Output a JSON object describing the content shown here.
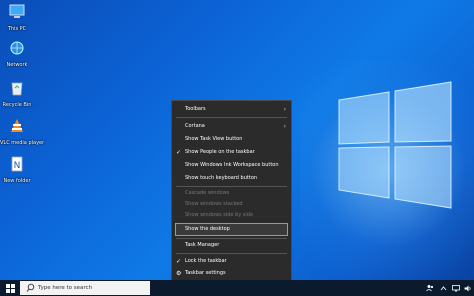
{
  "desktop_icons": [
    {
      "label": "This PC",
      "icon": "this-pc-icon"
    },
    {
      "label": "Network",
      "icon": "network-icon"
    },
    {
      "label": "Recycle Bin",
      "icon": "recycle-bin-icon"
    },
    {
      "label": "VLC media player",
      "icon": "vlc-icon"
    },
    {
      "label": "New folder",
      "icon": "document-icon"
    }
  ],
  "context_menu": {
    "items": [
      {
        "label": "Toolbars",
        "submenu": true
      },
      {
        "label": "Cortana",
        "submenu": true
      },
      {
        "label": "Show Task View button"
      },
      {
        "label": "Show People on the taskbar",
        "checked": true
      },
      {
        "label": "Show Windows Ink Workspace button"
      },
      {
        "label": "Show touch keyboard button"
      },
      {
        "label": "Cascade windows",
        "disabled": true
      },
      {
        "label": "Show windows stacked",
        "disabled": true
      },
      {
        "label": "Show windows side by side",
        "disabled": true
      },
      {
        "label": "Show the desktop",
        "highlighted": true
      },
      {
        "label": "Task Manager"
      },
      {
        "label": "Lock the taskbar",
        "checked": true
      },
      {
        "label": "Taskbar settings",
        "icon": "gear-icon"
      }
    ],
    "highlight_color": "#37d75a"
  },
  "taskbar": {
    "search_placeholder": "Type here to search"
  },
  "colors": {
    "desktop_bg": "#0c63d6",
    "menu_bg": "#2b2b2b",
    "taskbar_bg": "#0b1a2c"
  }
}
